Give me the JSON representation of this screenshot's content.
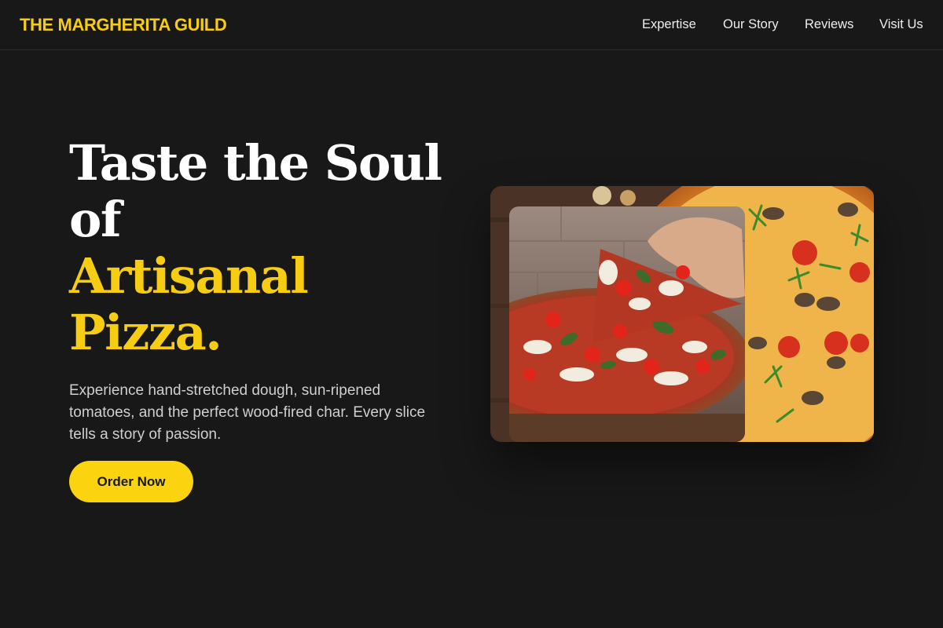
{
  "brand": {
    "name": "THE MARGHERITA GUILD"
  },
  "nav": {
    "items": [
      {
        "label": "Expertise"
      },
      {
        "label": "Our Story"
      },
      {
        "label": "Reviews"
      },
      {
        "label": "Visit Us"
      }
    ]
  },
  "hero": {
    "title_line1": "Taste the Soul",
    "title_line2": "of",
    "title_accent_line1": "Artisanal",
    "title_accent_line2": "Pizza.",
    "description": "Experience hand-stretched dough, sun-ripened tomatoes, and the perfect wood-fired char. Every slice tells a story of passion.",
    "cta_label": "Order Now"
  },
  "images": [
    {
      "icon": "pizza-photo-background"
    },
    {
      "icon": "pizza-slice-photo"
    }
  ],
  "colors": {
    "background": "#181818",
    "accent": "#f7cd14",
    "button": "#fbd30f",
    "text": "#ffffff",
    "muted_text": "#cfcfcf"
  }
}
